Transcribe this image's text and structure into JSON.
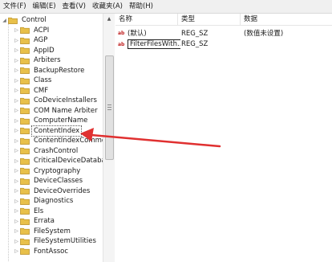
{
  "menu": [
    "文件(F)",
    "编辑(E)",
    "查看(V)",
    "收藏夹(A)",
    "帮助(H)"
  ],
  "tree": {
    "root": "Control",
    "items": [
      "ACPI",
      "AGP",
      "AppID",
      "Arbiters",
      "BackupRestore",
      "Class",
      "CMF",
      "CoDeviceInstallers",
      "COM Name Arbiter",
      "ComputerName",
      "ContentIndex",
      "ContentIndexCommon",
      "CrashControl",
      "CriticalDeviceDatabase",
      "Cryptography",
      "DeviceClasses",
      "DeviceOverrides",
      "Diagnostics",
      "Els",
      "Errata",
      "FileSystem",
      "FileSystemUtilities",
      "FontAssoc"
    ],
    "selected": "ContentIndex"
  },
  "list": {
    "columns": [
      "名称",
      "类型",
      "数据"
    ],
    "rows": [
      {
        "name": "(默认)",
        "type": "REG_SZ",
        "data": "(数值未设置)"
      },
      {
        "name": "FilterFilesWith...",
        "type": "REG_SZ",
        "data": ""
      }
    ]
  },
  "colors": {
    "folder": "#e8c04a",
    "arrow": "#e03030"
  }
}
